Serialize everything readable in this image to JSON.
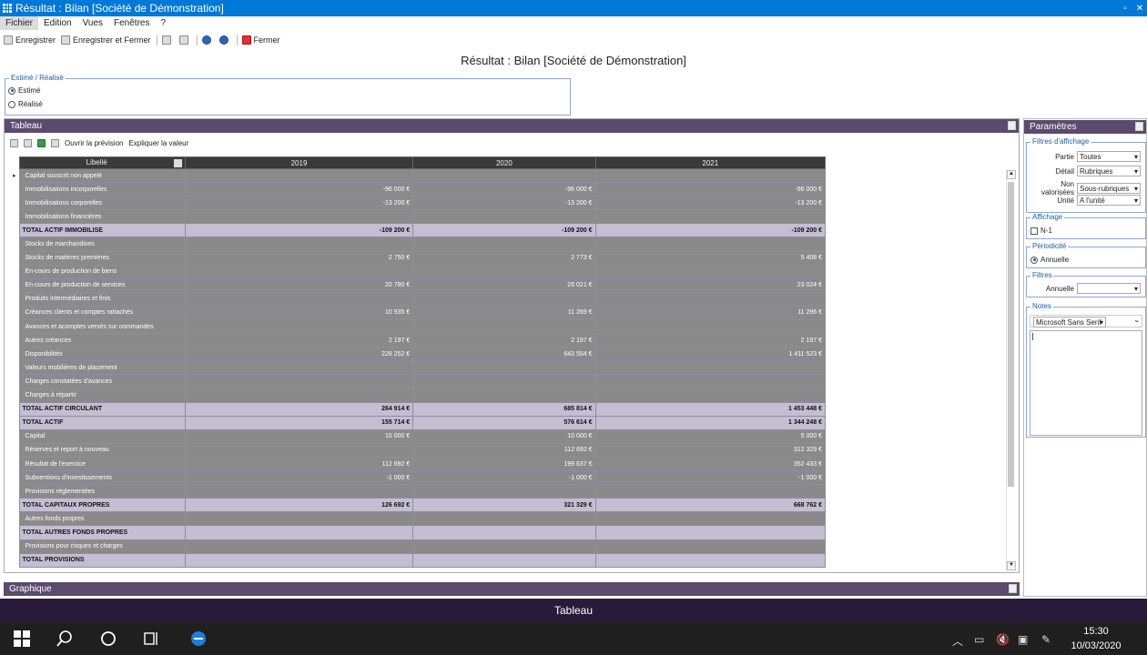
{
  "window": {
    "title": "Résultat : Bilan [Société de Démonstration]"
  },
  "menu": [
    "Fichier",
    "Edition",
    "Vues",
    "Fenêtres",
    "?"
  ],
  "toolbar": {
    "save": "Enregistrer",
    "save_close": "Enregistrer et Fermer",
    "close": "Fermer"
  },
  "page": {
    "title": "Résultat : Bilan [Société de Démonstration]"
  },
  "estime": {
    "legend": "Estimé / Réalisé",
    "opt1": "Estimé",
    "opt2": "Réalisé",
    "selected": "Estimé"
  },
  "tableau": {
    "title": "Tableau",
    "open_preview": "Ouvrir la prévision",
    "explain": "Expliquer la valeur",
    "columns": [
      "Libellé",
      "2019",
      "2020",
      "2021"
    ],
    "rows": [
      {
        "label": "Capital souscrit non appelé",
        "v": [
          "",
          "",
          ""
        ],
        "total": false
      },
      {
        "label": "Immobilisations incorporelles",
        "v": [
          "-96 000 €",
          "-96 000 €",
          "-96 000 €"
        ],
        "total": false
      },
      {
        "label": "Immobilisations corporelles",
        "v": [
          "-13 200 €",
          "-13 200 €",
          "-13 200 €"
        ],
        "total": false
      },
      {
        "label": "Immobilisations financières",
        "v": [
          "",
          "",
          ""
        ],
        "total": false
      },
      {
        "label": "TOTAL ACTIF IMMOBILISE",
        "v": [
          "-109 200 €",
          "-109 200 €",
          "-109 200 €"
        ],
        "total": true
      },
      {
        "label": "Stocks de marchandises",
        "v": [
          "",
          "",
          ""
        ],
        "total": false
      },
      {
        "label": "Stocks de matières premières",
        "v": [
          "2 750 €",
          "2 773 €",
          "5 408 €"
        ],
        "total": false
      },
      {
        "label": "En-cours de production de biens",
        "v": [
          "",
          "",
          ""
        ],
        "total": false
      },
      {
        "label": "En-cours de production de services",
        "v": [
          "20 780 €",
          "26 021 €",
          "23 024 €"
        ],
        "total": false
      },
      {
        "label": "Produits intermédiaires et finis",
        "v": [
          "",
          "",
          ""
        ],
        "total": false
      },
      {
        "label": "Créances clients et comptes rattachés",
        "v": [
          "10 935 €",
          "11 269 €",
          "11 296 €"
        ],
        "total": false
      },
      {
        "label": "Avances et acomptes versés sur commandes",
        "v": [
          "",
          "",
          ""
        ],
        "total": false
      },
      {
        "label": "Autres créances",
        "v": [
          "2 197 €",
          "2 197 €",
          "2 197 €"
        ],
        "total": false
      },
      {
        "label": "Disponibilités",
        "v": [
          "228 252 €",
          "643 554 €",
          "1 411 523 €"
        ],
        "total": false
      },
      {
        "label": "Valeurs mobilières de placement",
        "v": [
          "",
          "",
          ""
        ],
        "total": false
      },
      {
        "label": "Charges constatées d'avances",
        "v": [
          "",
          "",
          ""
        ],
        "total": false
      },
      {
        "label": "Charges à répartir",
        "v": [
          "",
          "",
          ""
        ],
        "total": false
      },
      {
        "label": "TOTAL ACTIF CIRCULANT",
        "v": [
          "264 914 €",
          "685 814 €",
          "1 453 448 €"
        ],
        "total": true
      },
      {
        "label": "TOTAL ACTIF",
        "v": [
          "155 714 €",
          "576 614 €",
          "1 344 248 €"
        ],
        "total": true
      },
      {
        "label": "Capital",
        "v": [
          "15 000 €",
          "10 000 €",
          "5 000 €"
        ],
        "total": false
      },
      {
        "label": "Réserves et report à nouveau",
        "v": [
          "",
          "112 692 €",
          "312 329 €"
        ],
        "total": false
      },
      {
        "label": "Résultat de l'exercice",
        "v": [
          "112 692 €",
          "199 637 €",
          "352 433 €"
        ],
        "total": false
      },
      {
        "label": "Subventions d'investissements",
        "v": [
          "-1 000 €",
          "-1 000 €",
          "-1 000 €"
        ],
        "total": false
      },
      {
        "label": "Provisions réglementées",
        "v": [
          "",
          "",
          ""
        ],
        "total": false
      },
      {
        "label": "TOTAL CAPITAUX PROPRES",
        "v": [
          "126 692 €",
          "321 329 €",
          "668 762 €"
        ],
        "total": true
      },
      {
        "label": "Autres fonds propres",
        "v": [
          "",
          "",
          ""
        ],
        "total": false
      },
      {
        "label": "TOTAL AUTRES FONDS PROPRES",
        "v": [
          "",
          "",
          ""
        ],
        "total": true
      },
      {
        "label": "Provisions pour risques et charges",
        "v": [
          "",
          "",
          ""
        ],
        "total": false
      },
      {
        "label": "TOTAL PROVISIONS",
        "v": [
          "",
          "",
          ""
        ],
        "total": true
      }
    ]
  },
  "graphique": {
    "title": "Graphique"
  },
  "params": {
    "title": "Paramètres",
    "filtres_affichage": "Filtres d'affichage",
    "partie_label": "Partie",
    "partie_value": "Toutes",
    "detail_label": "Détail",
    "detail_value": "Rubriques",
    "nonval_label": "Non valorisées",
    "nonval_value": "Sous-rubriques",
    "unite_label": "Unité",
    "unite_value": "A l'unité",
    "affichage": "Affichage",
    "n1": "N-1",
    "periodicite": "Périodicité",
    "annuelle": "Annuelle",
    "filtres": "Filtres",
    "filtre_label": "Annuelle",
    "filtre_value": "",
    "notes": "Notes",
    "font_value": "Microsoft Sans Serif"
  },
  "status": {
    "text": "Tableau"
  },
  "taskbar": {
    "time": "15:30",
    "date": "10/03/2020"
  }
}
